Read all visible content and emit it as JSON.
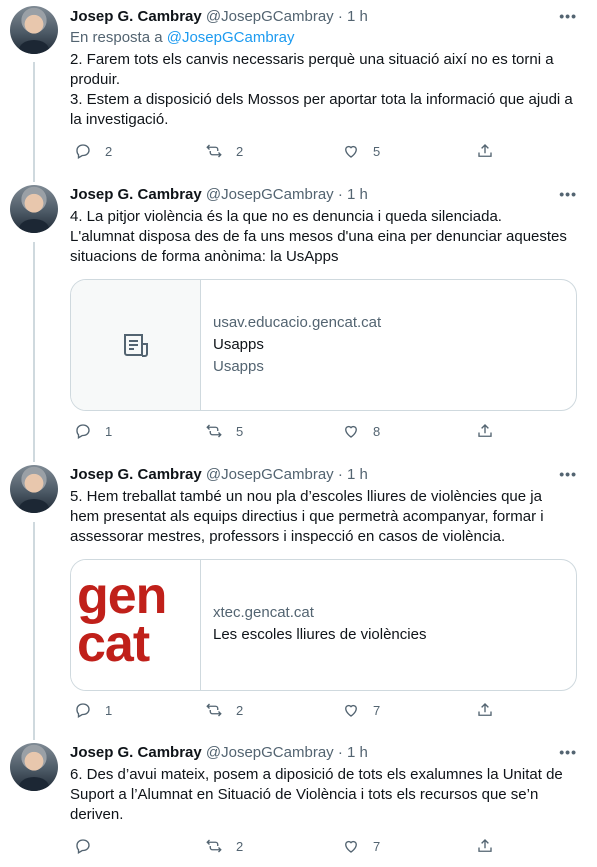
{
  "author": {
    "name": "Josep G. Cambray",
    "handle": "@JosepGCambray",
    "time": "1 h",
    "dot": "·"
  },
  "tweets": [
    {
      "reply_prefix": "En resposta a",
      "reply_handle": "@JosepGCambray",
      "text": "2. Farem tots els canvis necessaris perquè una situació així no es torni a produir.\n3. Estem a disposició dels Mossos per aportar tota la informació que ajudi a la investigació.",
      "replies": "2",
      "retweets": "2",
      "likes": "5"
    },
    {
      "text": "4. La pitjor violència és la que no es denuncia i queda silenciada.\nL'alumnat disposa des de fa uns mesos d'una eina per denunciar aquestes situacions de forma anònima: la UsApps",
      "card": {
        "domain": "usav.educacio.gencat.cat",
        "title": "Usapps",
        "description": "Usapps",
        "icon": "article-icon"
      },
      "replies": "1",
      "retweets": "5",
      "likes": "8"
    },
    {
      "text": "5. Hem treballat també un nou pla d’escoles lliures de violències que ja hem presentat als equips directius i que permetrà acompanyar, formar i assessorar mestres, professors i inspecció en casos de violència.",
      "card": {
        "domain": "xtec.gencat.cat",
        "title": "Les escoles lliures de violències",
        "logo_line1": "gen",
        "logo_line2": "cat"
      },
      "replies": "1",
      "retweets": "2",
      "likes": "7"
    },
    {
      "text": "6. Des d’avui mateix, posem a diposició de tots els exalumnes la Unitat de Suport a l’Alumnat en Situació de Violència i tots els recursos que se’n deriven.",
      "replies": "",
      "retweets": "2",
      "likes": "7"
    }
  ],
  "colors": {
    "accent": "#1d9bf0",
    "muted": "#536471",
    "border": "#cfd9de",
    "gencat_red": "#c0201a"
  }
}
